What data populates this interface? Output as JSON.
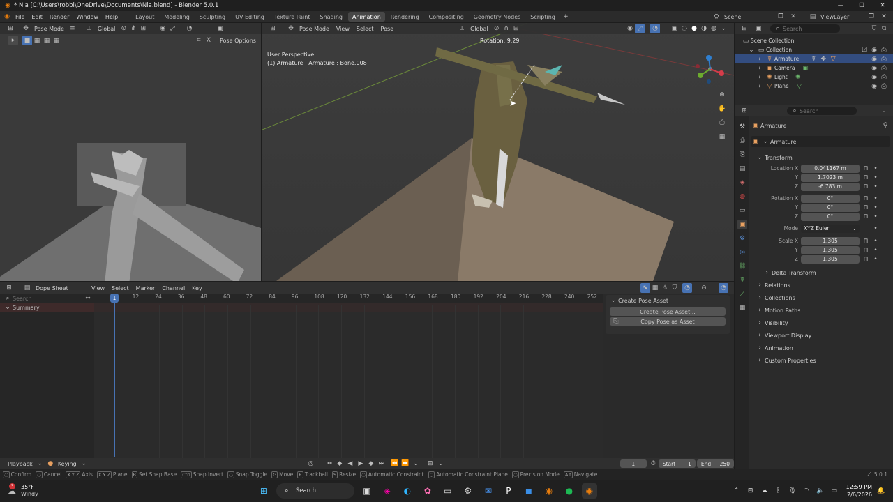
{
  "window": {
    "title": "* Nia [C:\\Users\\robbi\\OneDrive\\Documents\\Nia.blend] - Blender 5.0.1"
  },
  "menu": [
    "File",
    "Edit",
    "Render",
    "Window",
    "Help"
  ],
  "workspaces": [
    "Layout",
    "Modeling",
    "Sculpting",
    "UV Editing",
    "Texture Paint",
    "Shading",
    "Animation",
    "Rendering",
    "Compositing",
    "Geometry Nodes",
    "Scripting"
  ],
  "active_workspace": "Animation",
  "scene": {
    "label": "Scene",
    "view_layer": "ViewLayer"
  },
  "left_viewport": {
    "mode": "Pose Mode",
    "orientation": "Global",
    "pose_options": "Pose Options"
  },
  "main_viewport": {
    "mode": "Pose Mode",
    "menus": [
      "View",
      "Select",
      "Pose"
    ],
    "orientation": "Global",
    "perspective": "User Perspective",
    "context": "(1) Armature | Armature : Bone.008",
    "rotation_readout": "Rotation: 9.29"
  },
  "outliner": {
    "search_placeholder": "Search",
    "scene_collection": "Scene Collection",
    "collection": "Collection",
    "items": [
      "Armature",
      "Camera",
      "Light",
      "Plane"
    ]
  },
  "properties": {
    "search_placeholder": "Search",
    "object_name": "Armature",
    "datablock": "Armature",
    "transform_header": "Transform",
    "location_label": "Location X",
    "location": [
      "0.041167 m",
      "1.7023 m",
      "-6.783 m"
    ],
    "rotation_label": "Rotation X",
    "rotation": [
      "0°",
      "0°",
      "0°"
    ],
    "mode_label": "Mode",
    "mode_value": "XYZ Euler",
    "scale_label": "Scale X",
    "scale": [
      "1.305",
      "1.305",
      "1.305"
    ],
    "axis_y": "Y",
    "axis_z": "Z",
    "delta": "Delta Transform",
    "panels": [
      "Relations",
      "Collections",
      "Motion Paths",
      "Visibility",
      "Viewport Display",
      "Animation",
      "Custom Properties"
    ]
  },
  "dopesheet": {
    "editor": "Dope Sheet",
    "menus": [
      "View",
      "Select",
      "Marker",
      "Channel",
      "Key"
    ],
    "search_placeholder": "Search",
    "summary": "Summary",
    "frames": [
      "1",
      "12",
      "24",
      "36",
      "48",
      "60",
      "72",
      "84",
      "96",
      "108",
      "120",
      "132",
      "144",
      "156",
      "168",
      "180",
      "192",
      "204",
      "216",
      "228",
      "240",
      "252"
    ],
    "current_frame_marker": "1",
    "pose_panel_header": "Create Pose Asset",
    "create_pose_btn": "Create Pose Asset...",
    "copy_pose_btn": "Copy Pose as Asset"
  },
  "playback": {
    "playback": "Playback",
    "keying": "Keying",
    "current_frame": "1",
    "start_label": "Start",
    "start": "1",
    "end_label": "End",
    "end": "250"
  },
  "statusbar": {
    "items": [
      {
        "key": "",
        "label": "Confirm"
      },
      {
        "key": "",
        "label": "Cancel"
      },
      {
        "key": "X Y Z",
        "label": "Axis"
      },
      {
        "key": "X Y Z",
        "label": "Plane"
      },
      {
        "key": "B",
        "label": "Set Snap Base"
      },
      {
        "key": "Ctrl",
        "label": "Snap Invert"
      },
      {
        "key": "",
        "label": "Snap Toggle"
      },
      {
        "key": "G",
        "label": "Move"
      },
      {
        "key": "R",
        "label": "Trackball"
      },
      {
        "key": "S",
        "label": "Resize"
      },
      {
        "key": "",
        "label": "Automatic Constraint"
      },
      {
        "key": "",
        "label": "Automatic Constraint Plane"
      },
      {
        "key": "",
        "label": "Precision Mode"
      },
      {
        "key": "Alt",
        "label": "Navigate"
      }
    ],
    "version": "5.0.1"
  },
  "taskbar": {
    "weather_temp": "35°F",
    "weather_desc": "Windy",
    "weather_badge": "3",
    "search": "Search",
    "time": "12:59 PM",
    "date": "2/6/2026"
  }
}
